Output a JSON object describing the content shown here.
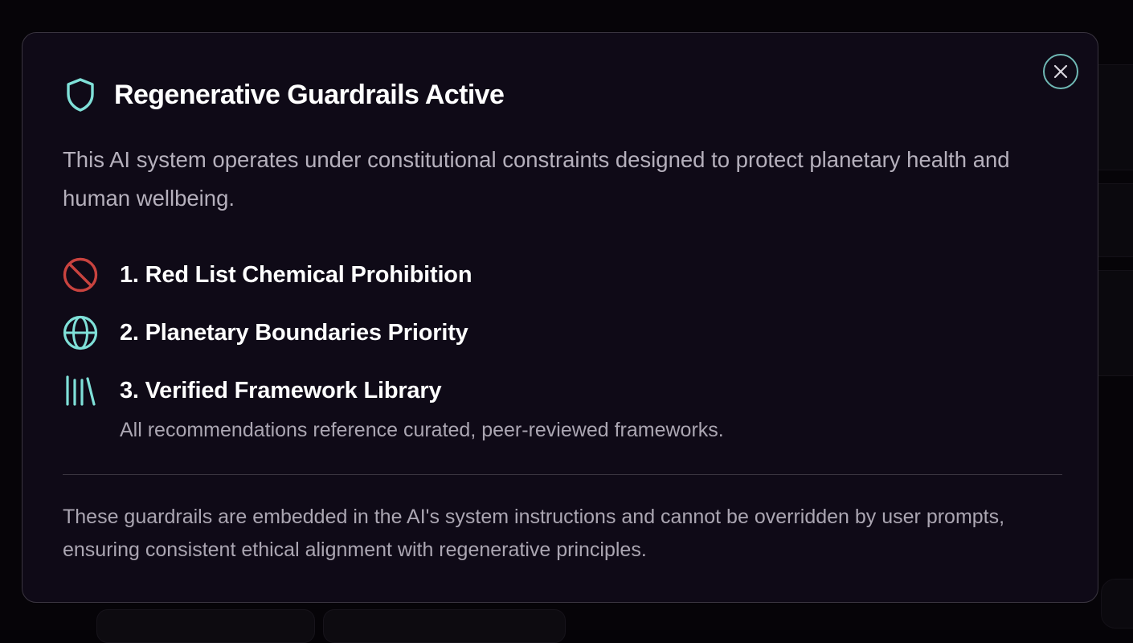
{
  "modal": {
    "title": "Regenerative Guardrails Active",
    "intro": "This AI system operates under constitutional constraints designed to protect planetary health and human wellbeing.",
    "rules": [
      {
        "title": "1. Red List Chemical Prohibition",
        "icon": "prohibited-icon"
      },
      {
        "title": "2. Planetary Boundaries Priority",
        "icon": "globe-icon"
      },
      {
        "title": "3. Verified Framework Library",
        "icon": "library-icon",
        "description": "All recommendations reference curated, peer-reviewed frameworks."
      }
    ],
    "footer": "These guardrails are embedded in the AI's system instructions and cannot be overridden by user prompts, ensuring consistent ethical alignment with regenerative principles.",
    "close_icon": "close-icon",
    "header_icon": "shield-icon"
  },
  "colors": {
    "accent": "#7fe0d8",
    "danger": "#c9433f",
    "background": "#0f0a17",
    "border": "#3a3540"
  }
}
